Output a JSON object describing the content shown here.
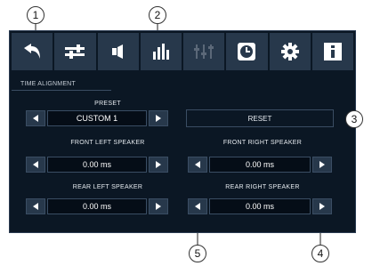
{
  "toolbar": {
    "icons": [
      "back-icon",
      "sliders-icon",
      "speaker-icon",
      "equalizer-icon",
      "mixer-icon",
      "clock-icon",
      "gear-icon",
      "info-icon"
    ]
  },
  "section": {
    "title": "TIME ALIGNMENT"
  },
  "preset": {
    "label": "PRESET",
    "value": "CUSTOM 1"
  },
  "reset": {
    "label": "RESET"
  },
  "speakers": {
    "front_left": {
      "label": "FRONT LEFT SPEAKER",
      "value": "0.00 ms"
    },
    "front_right": {
      "label": "FRONT RIGHT SPEAKER",
      "value": "0.00 ms"
    },
    "rear_left": {
      "label": "REAR LEFT SPEAKER",
      "value": "0.00 ms"
    },
    "rear_right": {
      "label": "REAR RIGHT SPEAKER",
      "value": "0.00 ms"
    }
  },
  "callouts": [
    "1",
    "2",
    "3",
    "4",
    "5"
  ],
  "colors": {
    "panel": "#0b1724",
    "button": "#27384b",
    "field": "#050d17",
    "text": "#ffffff"
  }
}
